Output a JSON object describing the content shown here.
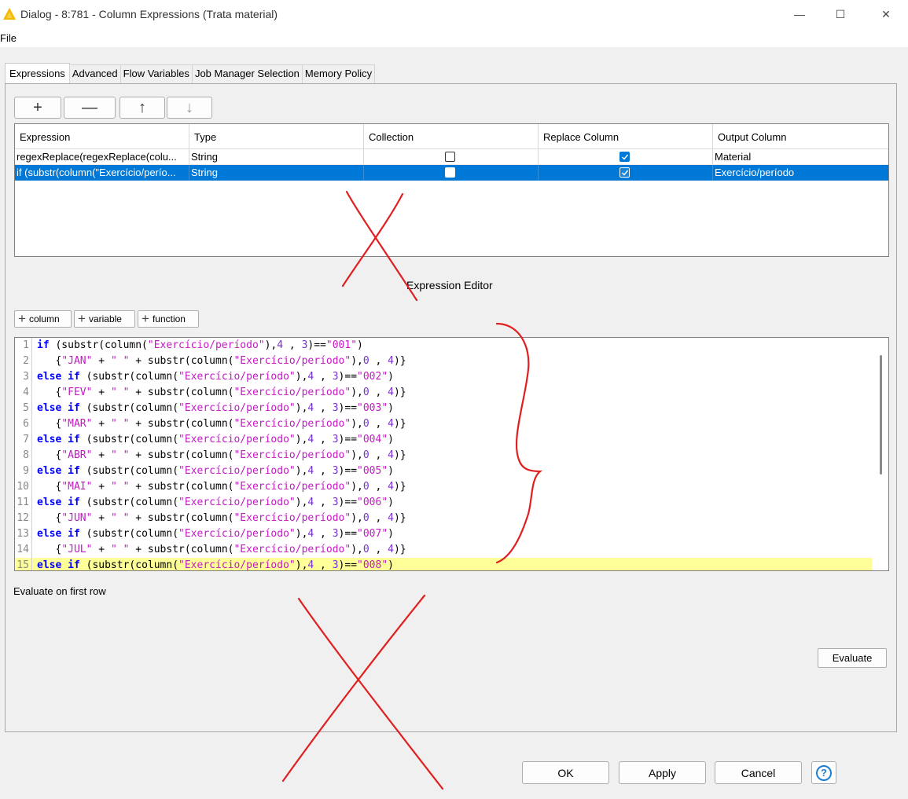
{
  "window": {
    "title": "Dialog - 8:781 - Column Expressions (Trata material)",
    "minimize": "—",
    "maximize": "☐",
    "close": "✕"
  },
  "menu": {
    "file": "File"
  },
  "tabs": [
    {
      "label": "Expressions",
      "active": true
    },
    {
      "label": "Advanced"
    },
    {
      "label": "Flow Variables"
    },
    {
      "label": "Job Manager Selection"
    },
    {
      "label": "Memory Policy"
    }
  ],
  "toolbar": {
    "add": "+",
    "remove": "—",
    "up": "↑",
    "down": "↓"
  },
  "table": {
    "headers": [
      "Expression",
      "Type",
      "Collection",
      "Replace Column",
      "Output Column"
    ],
    "rows": [
      {
        "expression": "regexReplace(regexReplace(colu...",
        "type": "String",
        "collection": false,
        "replace": true,
        "output": "Material",
        "selected": false
      },
      {
        "expression": "if (substr(column(\"Exercício/perío...",
        "type": "String",
        "collection": false,
        "replace": true,
        "output": "Exercício/período",
        "selected": true
      }
    ]
  },
  "editor": {
    "label": "Expression Editor",
    "column_btn": "column",
    "variable_btn": "variable",
    "function_btn": "function",
    "current_line": 15,
    "lines": [
      {
        "n": "1",
        "indent": "",
        "kind": "if",
        "code": "if (substr(column(\"Exercício/período\"),4 , 3)==\"001\")"
      },
      {
        "n": "2",
        "indent": "   ",
        "kind": "body",
        "month": "JAN"
      },
      {
        "n": "3",
        "kind": "elseif",
        "value": "002"
      },
      {
        "n": "4",
        "kind": "body",
        "month": "FEV"
      },
      {
        "n": "5",
        "kind": "elseif",
        "value": "003"
      },
      {
        "n": "6",
        "kind": "body",
        "month": "MAR"
      },
      {
        "n": "7",
        "kind": "elseif",
        "value": "004"
      },
      {
        "n": "8",
        "kind": "body",
        "month": "ABR"
      },
      {
        "n": "9",
        "kind": "elseif",
        "value": "005"
      },
      {
        "n": "10",
        "kind": "body",
        "month": "MAI"
      },
      {
        "n": "11",
        "kind": "elseif",
        "value": "006"
      },
      {
        "n": "12",
        "kind": "body",
        "month": "JUN"
      },
      {
        "n": "13",
        "kind": "elseif",
        "value": "007"
      },
      {
        "n": "14",
        "kind": "body",
        "month": "JUL"
      },
      {
        "n": "15",
        "kind": "elseif",
        "value": "008"
      }
    ]
  },
  "evaluate": {
    "label": "Evaluate on first row",
    "button": "Evaluate"
  },
  "buttons": {
    "ok": "OK",
    "apply": "Apply",
    "cancel": "Cancel",
    "help": "?"
  },
  "colors": {
    "accent": "#0078d7",
    "annotation": "#e02020",
    "keyword": "#0000ff",
    "string": "#c41ac4",
    "number": "#7a2fd2"
  }
}
